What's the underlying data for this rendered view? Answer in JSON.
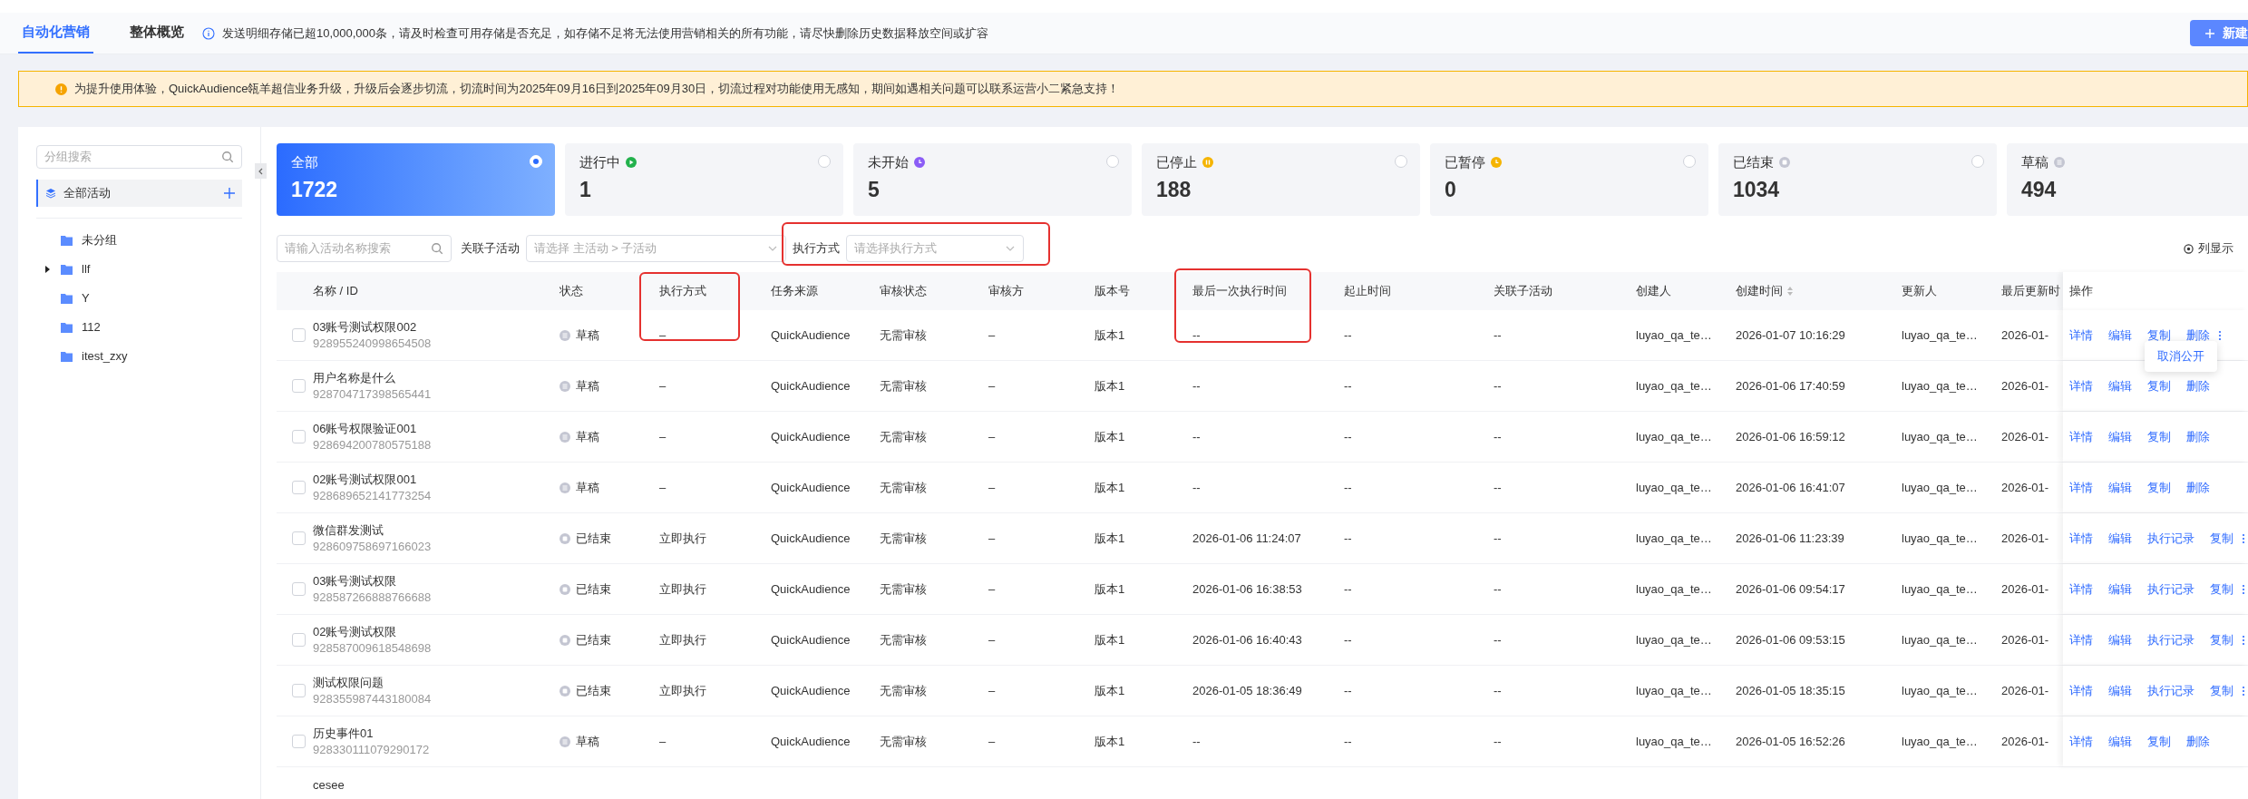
{
  "tabs": [
    {
      "label": "自动化营销",
      "selected": true
    },
    {
      "label": "整体概览",
      "selected": false
    }
  ],
  "storage_notice": "发送明细存储已超10,000,000条，请及时检查可用存储是否充足，如存储不足将无法使用营销相关的所有功能，请尽快删除历史数据释放空间或扩容",
  "create_button": "新建",
  "banner": "为提升使用体验，QuickAudience瓴羊超信业务升级，升级后会逐步切流，切流时间为2025年09月16日到2025年09月30日，切流过程对功能使用无感知，期间如遇相关问题可以联系运营小二紧急支持！",
  "sidebar": {
    "search_placeholder": "分组搜索",
    "root": {
      "label": "全部活动",
      "selected": true
    },
    "items": [
      {
        "label": "未分组",
        "kind": "leaf"
      },
      {
        "label": "llf",
        "kind": "branch"
      },
      {
        "label": "Y",
        "kind": "leaf"
      },
      {
        "label": "112",
        "kind": "leaf"
      },
      {
        "label": "itest_zxy",
        "kind": "leaf"
      }
    ]
  },
  "cards": [
    {
      "label": "全部",
      "count": "1722",
      "kind": "all",
      "selected": true
    },
    {
      "label": "进行中",
      "count": "1",
      "kind": "running",
      "selected": false
    },
    {
      "label": "未开始",
      "count": "5",
      "kind": "pending",
      "selected": false
    },
    {
      "label": "已停止",
      "count": "188",
      "kind": "stopped",
      "selected": false
    },
    {
      "label": "已暂停",
      "count": "0",
      "kind": "paused",
      "selected": false
    },
    {
      "label": "已结束",
      "count": "1034",
      "kind": "ended",
      "selected": false
    },
    {
      "label": "草稿",
      "count": "494",
      "kind": "draft",
      "selected": false
    }
  ],
  "filters": {
    "search_placeholder": "请输入活动名称搜索",
    "sub_activity_label": "关联子活动",
    "sub_activity_placeholder": "请选择 主活动 > 子活动",
    "exec_label": "执行方式",
    "exec_placeholder": "请选择执行方式",
    "columns_button": "列显示"
  },
  "table": {
    "columns": [
      {
        "label": "名称 / ID",
        "sortable": false
      },
      {
        "label": "状态",
        "sortable": false
      },
      {
        "label": "执行方式",
        "sortable": false
      },
      {
        "label": "任务来源",
        "sortable": false
      },
      {
        "label": "审核状态",
        "sortable": false
      },
      {
        "label": "审核方",
        "sortable": false
      },
      {
        "label": "版本号",
        "sortable": false
      },
      {
        "label": "最后一次执行时间",
        "sortable": false
      },
      {
        "label": "起止时间",
        "sortable": false
      },
      {
        "label": "关联子活动",
        "sortable": false
      },
      {
        "label": "创建人",
        "sortable": false
      },
      {
        "label": "创建时间",
        "sortable": true
      },
      {
        "label": "更新人",
        "sortable": false
      },
      {
        "label": "最后更新时",
        "sortable": false
      },
      {
        "label": "操作",
        "sortable": false
      }
    ],
    "rows": [
      {
        "checked": false,
        "cells": [
          {
            "name": "03账号测试权限002",
            "id": "928955240998654508"
          },
          {
            "label": "草稿",
            "kind": "draft"
          },
          "–",
          "QuickAudience",
          "无需审核",
          "–",
          "版本1",
          "--",
          "--",
          "--",
          "luyao_qa_te…",
          "2026-01-07 10:16:29",
          "luyao_qa_te…",
          "2026-01-",
          {
            "actions": [
              "详情",
              "编辑",
              "复制",
              "删除"
            ],
            "more": true,
            "menu": [
              "取消公开"
            ]
          }
        ]
      },
      {
        "checked": false,
        "cells": [
          {
            "name": "用户名称是什么",
            "id": "928704717398565441"
          },
          {
            "label": "草稿",
            "kind": "draft"
          },
          "–",
          "QuickAudience",
          "无需审核",
          "–",
          "版本1",
          "--",
          "--",
          "--",
          "luyao_qa_te…",
          "2026-01-06 17:40:59",
          "luyao_qa_te…",
          "2026-01-",
          {
            "actions": [
              "详情",
              "编辑",
              "复制",
              "删除"
            ],
            "more": false
          }
        ]
      },
      {
        "checked": false,
        "cells": [
          {
            "name": "06账号权限验证001",
            "id": "928694200780575188"
          },
          {
            "label": "草稿",
            "kind": "draft"
          },
          "–",
          "QuickAudience",
          "无需审核",
          "–",
          "版本1",
          "--",
          "--",
          "--",
          "luyao_qa_te…",
          "2026-01-06 16:59:12",
          "luyao_qa_te…",
          "2026-01-",
          {
            "actions": [
              "详情",
              "编辑",
              "复制",
              "删除"
            ],
            "more": false
          }
        ]
      },
      {
        "checked": false,
        "cells": [
          {
            "name": "02账号测试权限001",
            "id": "928689652141773254"
          },
          {
            "label": "草稿",
            "kind": "draft"
          },
          "–",
          "QuickAudience",
          "无需审核",
          "–",
          "版本1",
          "--",
          "--",
          "--",
          "luyao_qa_te…",
          "2026-01-06 16:41:07",
          "luyao_qa_te…",
          "2026-01-",
          {
            "actions": [
              "详情",
              "编辑",
              "复制",
              "删除"
            ],
            "more": false
          }
        ]
      },
      {
        "checked": false,
        "cells": [
          {
            "name": "微信群发测试",
            "id": "928609758697166023"
          },
          {
            "label": "已结束",
            "kind": "ended"
          },
          "立即执行",
          "QuickAudience",
          "无需审核",
          "–",
          "版本1",
          "2026-01-06 11:24:07",
          "--",
          "--",
          "luyao_qa_te…",
          "2026-01-06 11:23:39",
          "luyao_qa_te…",
          "2026-01-",
          {
            "actions": [
              "详情",
              "编辑",
              "执行记录",
              "复制"
            ],
            "more": true
          }
        ]
      },
      {
        "checked": false,
        "cells": [
          {
            "name": "03账号测试权限",
            "id": "928587266888766688"
          },
          {
            "label": "已结束",
            "kind": "ended"
          },
          "立即执行",
          "QuickAudience",
          "无需审核",
          "–",
          "版本1",
          "2026-01-06 16:38:53",
          "--",
          "--",
          "luyao_qa_te…",
          "2026-01-06 09:54:17",
          "luyao_qa_te…",
          "2026-01-",
          {
            "actions": [
              "详情",
              "编辑",
              "执行记录",
              "复制"
            ],
            "more": true
          }
        ]
      },
      {
        "checked": false,
        "cells": [
          {
            "name": "02账号测试权限",
            "id": "928587009618548698"
          },
          {
            "label": "已结束",
            "kind": "ended"
          },
          "立即执行",
          "QuickAudience",
          "无需审核",
          "–",
          "版本1",
          "2026-01-06 16:40:43",
          "--",
          "--",
          "luyao_qa_te…",
          "2026-01-06 09:53:15",
          "luyao_qa_te…",
          "2026-01-",
          {
            "actions": [
              "详情",
              "编辑",
              "执行记录",
              "复制"
            ],
            "more": true
          }
        ]
      },
      {
        "checked": false,
        "cells": [
          {
            "name": "测试权限问题",
            "id": "928355987443180084"
          },
          {
            "label": "已结束",
            "kind": "ended"
          },
          "立即执行",
          "QuickAudience",
          "无需审核",
          "–",
          "版本1",
          "2026-01-05 18:36:49",
          "--",
          "--",
          "luyao_qa_te…",
          "2026-01-05 18:35:15",
          "luyao_qa_te…",
          "2026-01-",
          {
            "actions": [
              "详情",
              "编辑",
              "执行记录",
              "复制"
            ],
            "more": true
          }
        ]
      },
      {
        "checked": false,
        "cells": [
          {
            "name": "历史事件01",
            "id": "928330111079290172"
          },
          {
            "label": "草稿",
            "kind": "draft"
          },
          "–",
          "QuickAudience",
          "无需审核",
          "–",
          "版本1",
          "--",
          "--",
          "--",
          "luyao_qa_te…",
          "2026-01-05 16:52:26",
          "luyao_qa_te…",
          "2026-01-",
          {
            "actions": [
              "详情",
              "编辑",
              "复制",
              "删除"
            ],
            "more": false
          }
        ]
      }
    ],
    "partial_row": {
      "name": "cesee"
    }
  }
}
